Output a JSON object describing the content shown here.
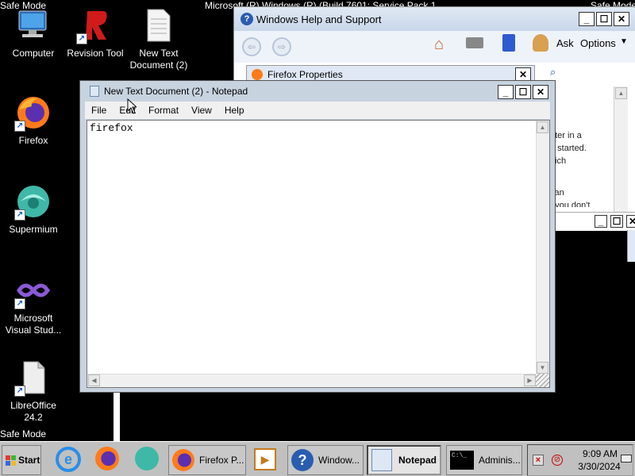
{
  "desktop": {
    "top_left_label": "Safe Mode",
    "bottom_left_label": "Safe Mode",
    "top_center_label": "Microsoft (R) Windows (R) (Build 7601: Service Pack 1)",
    "top_right_label": "Safe Mode",
    "icons": [
      {
        "label": "Computer"
      },
      {
        "label": "Revision Tool"
      },
      {
        "label": "New Text Document (2)"
      },
      {
        "label": "Firefox"
      },
      {
        "label": "Supermium"
      },
      {
        "label": "Microsoft Visual Stud..."
      },
      {
        "label": "LibreOffice 24.2"
      }
    ]
  },
  "help_window": {
    "title": "Windows Help and Support",
    "toolbar": {
      "ask": "Ask",
      "options": "Options"
    },
    "body_fragments": [
      "uter in a",
      "e started.",
      "hich",
      "can",
      "f you don't"
    ]
  },
  "firefox_props": {
    "title": "Firefox Properties"
  },
  "notepad": {
    "title": "New Text Document (2) - Notepad",
    "menu": [
      "File",
      "Edit",
      "Format",
      "View",
      "Help"
    ],
    "content": "firefox"
  },
  "taskbar": {
    "start": "Start",
    "tasks": [
      {
        "label": "Firefox P..."
      },
      {
        "label": "Window..."
      },
      {
        "label": "Notepad"
      },
      {
        "label": "Adminis..."
      }
    ],
    "clock": {
      "time": "9:09 AM",
      "date": "3/30/2024"
    }
  },
  "colors": {
    "desktop": "#000000",
    "taskbar": "#c0c0c0",
    "titlebar": "#c8d3e0"
  }
}
